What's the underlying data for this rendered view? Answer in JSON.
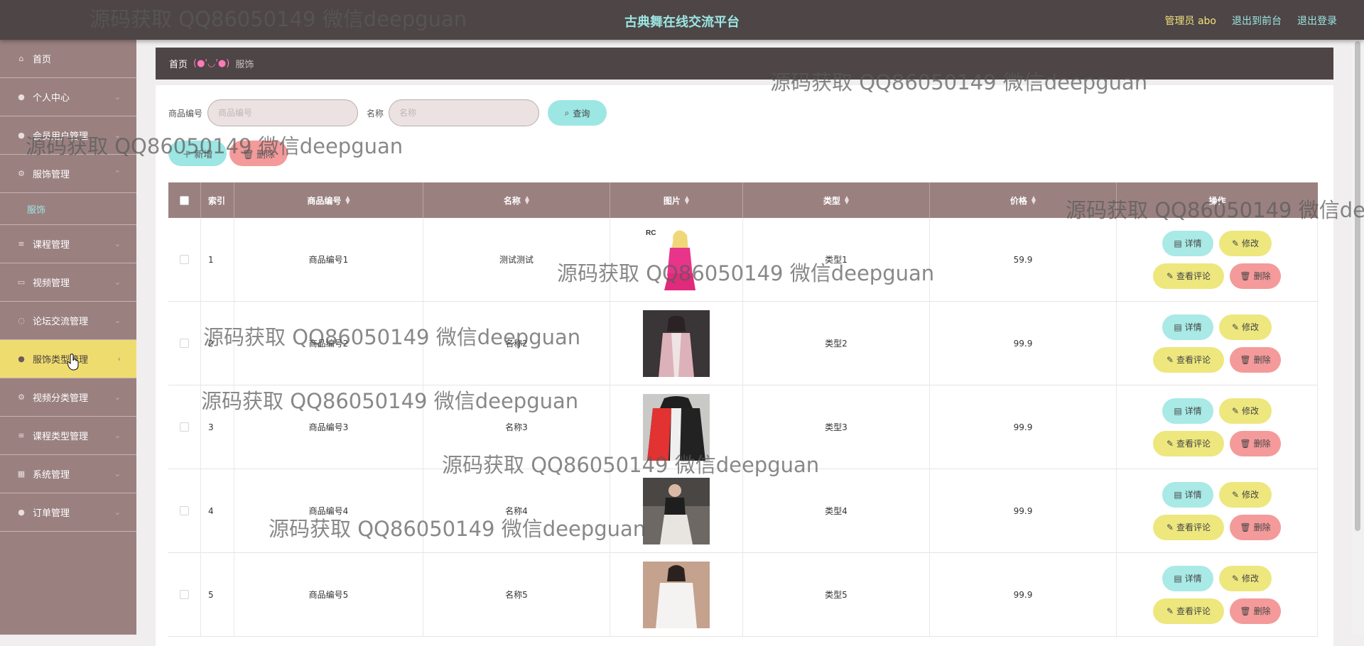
{
  "header": {
    "title": "古典舞在线交流平台",
    "admin": "管理员 abo",
    "to_front": "退出到前台",
    "logout": "退出登录"
  },
  "sidebar": {
    "items": [
      {
        "label": "首页",
        "icon": "home-icon"
      },
      {
        "label": "个人中心",
        "icon": "user-icon"
      },
      {
        "label": "会员用户管理",
        "icon": "user-icon"
      },
      {
        "label": "服饰管理",
        "icon": "gear-icon"
      },
      {
        "label": "课程管理",
        "icon": "list-icon"
      },
      {
        "label": "视频管理",
        "icon": "video-icon"
      },
      {
        "label": "论坛交流管理",
        "icon": "chat-icon"
      },
      {
        "label": "服饰类型管理",
        "icon": "user-icon",
        "active": true
      },
      {
        "label": "视频分类管理",
        "icon": "gear-icon"
      },
      {
        "label": "课程类型管理",
        "icon": "list-icon"
      },
      {
        "label": "系统管理",
        "icon": "grid-icon"
      },
      {
        "label": "订单管理",
        "icon": "user-icon"
      }
    ],
    "sub_item": "服饰"
  },
  "breadcrumb": {
    "home": "首页",
    "sep": "(●'◡'●)",
    "current": "服饰"
  },
  "search": {
    "code_label": "商品编号",
    "code_placeholder": "商品编号",
    "name_label": "名称",
    "name_placeholder": "名称",
    "query_label": "查询"
  },
  "actions": {
    "add_label": "新增",
    "delete_label": "删除"
  },
  "table": {
    "headers": {
      "index": "索引",
      "code": "商品编号",
      "name": "名称",
      "image": "图片",
      "type": "类型",
      "price": "价格",
      "op": "操作"
    },
    "rows": [
      {
        "index": "1",
        "code": "商品编号1",
        "name": "测试测试",
        "type": "类型1",
        "price": "59.9",
        "image_label": "RC"
      },
      {
        "index": "2",
        "code": "商品编号2",
        "name": "名称2",
        "type": "类型2",
        "price": "99.9"
      },
      {
        "index": "3",
        "code": "商品编号3",
        "name": "名称3",
        "type": "类型3",
        "price": "99.9"
      },
      {
        "index": "4",
        "code": "商品编号4",
        "name": "名称4",
        "type": "类型4",
        "price": "99.9"
      },
      {
        "index": "5",
        "code": "商品编号5",
        "name": "名称5",
        "type": "类型5",
        "price": "99.9"
      }
    ],
    "op_labels": {
      "detail": "详情",
      "edit": "修改",
      "comment": "查看评论",
      "delete": "删除"
    }
  },
  "watermark": "源码获取 QQ86050149 微信deepguan",
  "colors": {
    "topbar": "#4d4546",
    "sidebar": "#9a8180",
    "accent_cyan": "#9ce6e3",
    "accent_yellow": "#ede77e",
    "accent_red": "#f49a9a",
    "active_item": "#efdc6f"
  }
}
